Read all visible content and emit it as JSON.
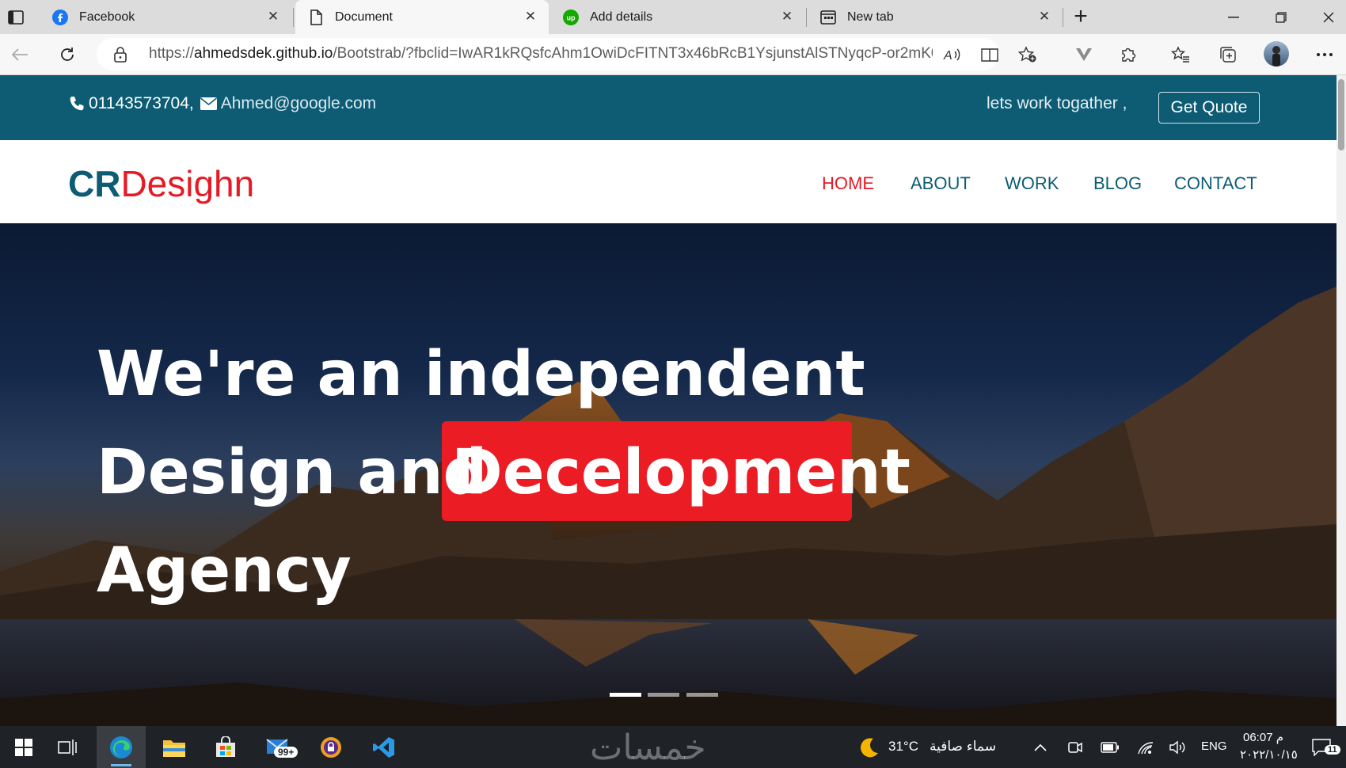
{
  "browser": {
    "tabs": [
      {
        "title": "Facebook",
        "icon": "facebook-icon"
      },
      {
        "title": "Document",
        "icon": "document-icon"
      },
      {
        "title": "Add details",
        "icon": "upwork-icon"
      },
      {
        "title": "New tab",
        "icon": "new-tab-icon"
      }
    ],
    "new_tab_symbol": "+",
    "close_symbol": "✕",
    "url_prefix": "https://",
    "url_host": "ahmedsdek.github.io",
    "url_rest": "/Bootstrab/?fbclid=IwAR1kRQsfcAhm1OwiDcFITNT3x46bRcB1YsjunstAlSTNyqcP-or2mK0..."
  },
  "site": {
    "phone": "01143573704,",
    "email": "Ahmed@google.com",
    "tagline": "lets work togather ,",
    "quote_label": "Get Quote",
    "logo_cr": "CR",
    "logo_rest": "Desighn",
    "nav": [
      "HOME",
      "ABOUT",
      "WORK",
      "BLOG",
      "CONTACT"
    ],
    "hero_line1": "We're an independent",
    "hero_line2a": "Design and",
    "hero_line2b": "Decelopment",
    "hero_line3": "Agency"
  },
  "taskbar": {
    "mail_badge": "99+",
    "weather_temp": "31°C",
    "weather_desc": "سماء صافية",
    "lang": "ENG",
    "time": "06:07 م",
    "date": "٢٠٢٢/١٠/١٥",
    "notif_count": "11",
    "watermark": "خمسات"
  },
  "colors": {
    "brand_teal": "#0d5c74",
    "brand_red": "#e51a24"
  }
}
